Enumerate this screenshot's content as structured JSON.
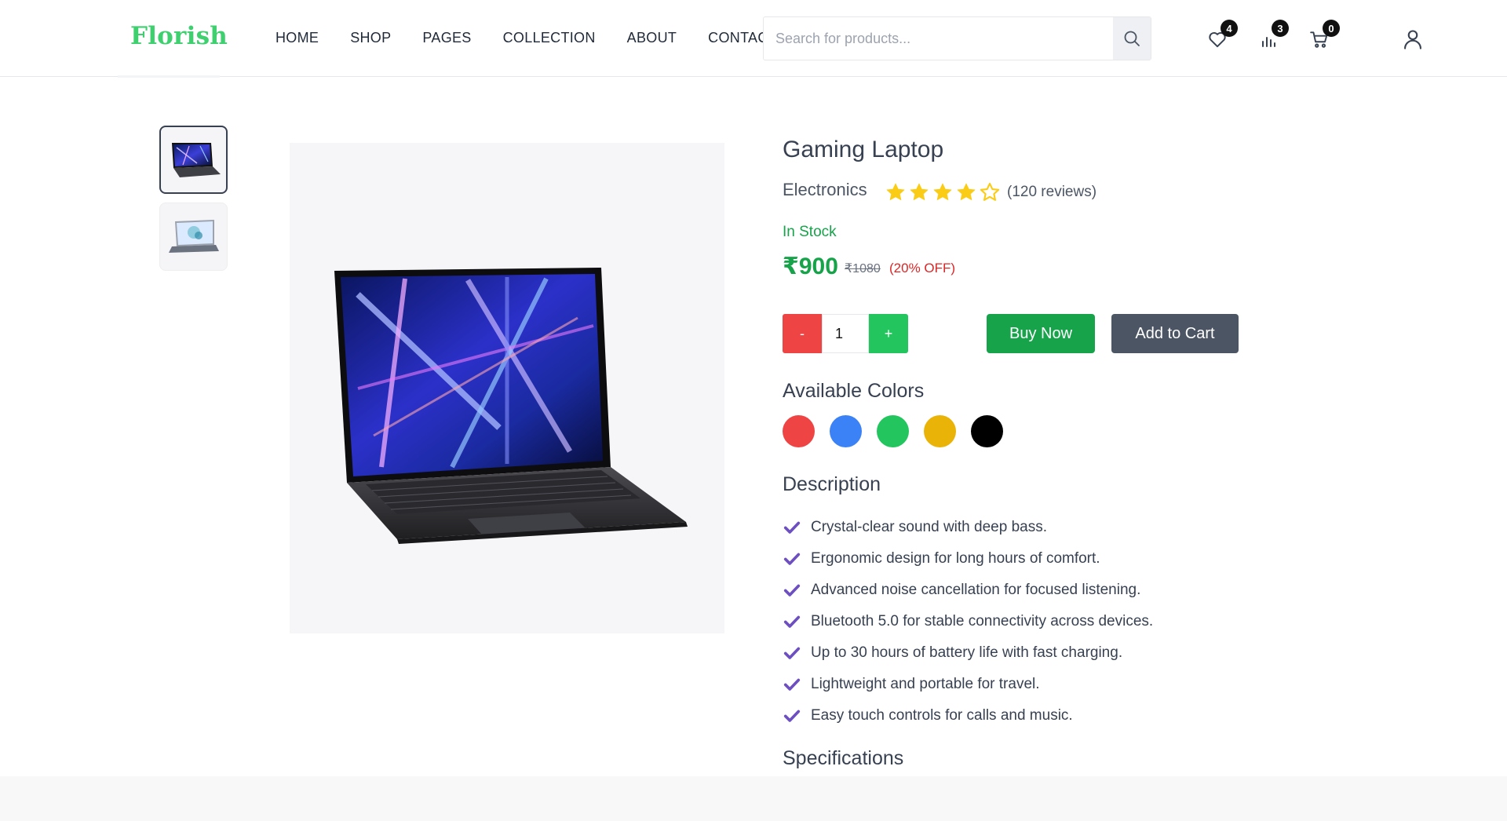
{
  "header": {
    "logo": "Florish",
    "nav": [
      "HOME",
      "SHOP",
      "PAGES",
      "COLLECTION",
      "ABOUT",
      "CONTACT"
    ],
    "search_placeholder": "Search for products...",
    "wishlist_count": "4",
    "compare_count": "3",
    "cart_count": "0",
    "icons": [
      "search-icon",
      "heart-icon",
      "bar-chart-icon",
      "cart-icon",
      "user-icon"
    ]
  },
  "product": {
    "title": "Gaming Laptop",
    "category": "Electronics",
    "rating": 4,
    "rating_max": 5,
    "reviews": "(120 reviews)",
    "stock": "In Stock",
    "price": "₹900",
    "old_price": "₹1080",
    "discount": "(20% OFF)",
    "quantity": "1",
    "minus_label": "-",
    "plus_label": "+",
    "buy_label": "Buy Now",
    "cart_label": "Add to Cart",
    "colors_title": "Available Colors",
    "colors": [
      "#ef4444",
      "#3b82f6",
      "#22c55e",
      "#eab308",
      "#000000"
    ],
    "description_title": "Description",
    "description": [
      "Crystal-clear sound with deep bass.",
      "Ergonomic design for long hours of comfort.",
      "Advanced noise cancellation for focused listening.",
      "Bluetooth 5.0 for stable connectivity across devices.",
      "Up to 30 hours of battery life with fast charging.",
      "Lightweight and portable for travel.",
      "Easy touch controls for calls and music."
    ],
    "specifications_title": "Specifications"
  },
  "theme": {
    "brand": "#3ecf6e",
    "success": "#16a34a",
    "danger": "#ef4444",
    "star": "#facc15",
    "check": "#6d4fc2"
  }
}
